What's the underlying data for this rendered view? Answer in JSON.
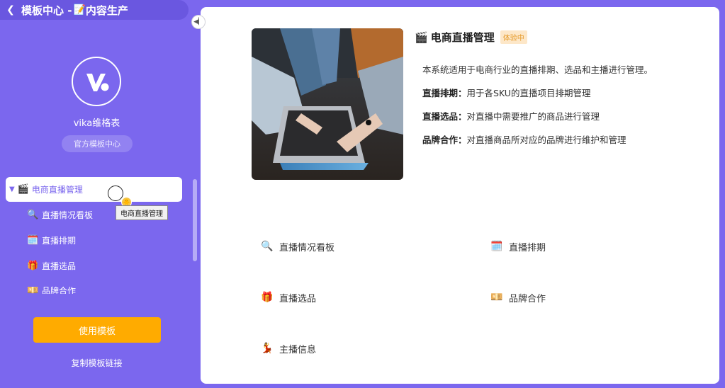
{
  "topbar": {
    "back_icon": "chevron-left-icon",
    "title": "模板中心 - ",
    "title_emoji": "📝",
    "title_suffix": "内容生产"
  },
  "brand": {
    "name": "vika维格表",
    "badge": "官方模板中心"
  },
  "tree": {
    "active": {
      "emoji": "🎬",
      "label": "电商直播管理"
    },
    "items": [
      {
        "emoji": "🔍",
        "label": "直播情况看板"
      },
      {
        "emoji": "🗓️",
        "label": "直播排期"
      },
      {
        "emoji": "🎁",
        "label": "直播选品"
      },
      {
        "emoji": "💴",
        "label": "品牌合作"
      }
    ]
  },
  "tooltip": "电商直播管理",
  "actions": {
    "use_template": "使用模板",
    "copy_link": "复制模板链接"
  },
  "template": {
    "emoji": "🎬",
    "title": "电商直播管理",
    "badge": "体验中",
    "intro": "本系统适用于电商行业的直播排期、选品和主播进行管理。",
    "features": [
      {
        "name": "直播排期：",
        "text": "用于各SKU的直播项目排期管理"
      },
      {
        "name": "直播选品：",
        "text": "对直播中需要推广的商品进行管理"
      },
      {
        "name": "品牌合作：",
        "text": "对直播商品所对应的品牌进行维护和管理"
      }
    ]
  },
  "links": [
    {
      "emoji": "🔍",
      "label": "直播情况看板"
    },
    {
      "emoji": "🗓️",
      "label": "直播排期"
    },
    {
      "emoji": "🎁",
      "label": "直播选品"
    },
    {
      "emoji": "💴",
      "label": "品牌合作"
    },
    {
      "emoji": "💃",
      "label": "主播信息"
    }
  ],
  "colors": {
    "sidebar": "#7b67ee",
    "accent": "#ffab00",
    "badge_bg": "#fde7c8",
    "badge_text": "#e59b2b"
  }
}
